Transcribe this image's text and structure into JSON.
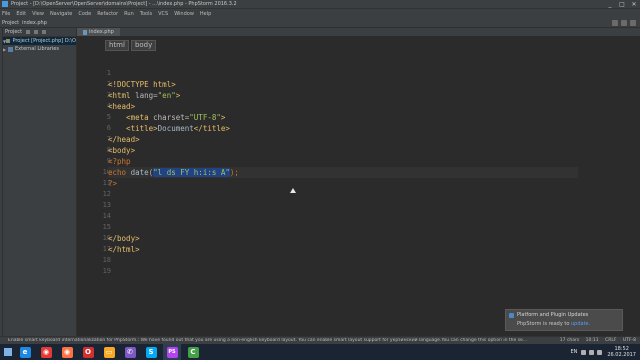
{
  "window": {
    "title": "Project - [D:\\OpenServer\\OpenServer\\domains\\Project] - ...\\index.php - PhpStorm 2016.3.2",
    "controls": [
      "_",
      "□",
      "✕"
    ]
  },
  "menu": [
    "File",
    "Edit",
    "View",
    "Navigate",
    "Code",
    "Refactor",
    "Run",
    "Tools",
    "VCS",
    "Window",
    "Help"
  ],
  "nav": {
    "crumbs": [
      "Project",
      "index.php"
    ]
  },
  "project_panel": {
    "header": "Project",
    "items": [
      {
        "label": "Project [Project.php] D:\\O",
        "selected": true,
        "kind": "folder"
      },
      {
        "label": "External Libraries",
        "selected": false,
        "kind": "libs"
      }
    ]
  },
  "editor": {
    "tab": "index.php",
    "breadcrumbs": [
      "html",
      "body"
    ],
    "line_numbers": [
      "1",
      "2",
      "3",
      "4",
      "5",
      "6",
      "7",
      "8",
      "9",
      "10",
      "11",
      "12",
      "13",
      "14",
      "15",
      "16",
      "17",
      "18",
      "19"
    ],
    "current_line": 10,
    "code": {
      "l2": "<!DOCTYPE html>",
      "l3_open": "<html ",
      "l3_attr": "lang=",
      "l3_val": "\"en\"",
      "l3_close": ">",
      "l4": "<head>",
      "l5_open": "    <meta ",
      "l5_attr": "charset=",
      "l5_val": "\"UTF-8\"",
      "l5_close": ">",
      "l6_open": "    <title>",
      "l6_text": "Document",
      "l6_close": "</title>",
      "l7": "</head>",
      "l8": "<body>",
      "l9": "<?php",
      "l10_kw": "echo ",
      "l10_fn": "date(",
      "l10_arg": "\"l ds FY h:i:s A\"",
      "l10_end": ");",
      "l11": "?>",
      "l16": "</body>",
      "l17": "</html>"
    }
  },
  "notification": {
    "title": "Platform and Plugin Updates",
    "body_prefix": "PhpStorm is ready to ",
    "link": "update."
  },
  "statusbar": {
    "message": "Enable smart keyboard internationalization for PhpStorm.: We have found out that you are using a non-english keyboard layout. You can enable smart layout support for укрэинский language.You can change this option in the se... (8 minutes ago)",
    "chars": "17 chars",
    "position": "10:11",
    "line_sep": "CRLF",
    "encoding": "UTF-8"
  },
  "taskbar": {
    "apps": [
      {
        "name": "ie",
        "glyph": "e",
        "color": "#1e88e5"
      },
      {
        "name": "chrome",
        "glyph": "◉",
        "color": "#e53935"
      },
      {
        "name": "firefox",
        "glyph": "◉",
        "color": "#ff7043"
      },
      {
        "name": "opera",
        "glyph": "O",
        "color": "#d32f2f"
      },
      {
        "name": "explorer",
        "glyph": "▭",
        "color": "#f9a825"
      },
      {
        "name": "viber",
        "glyph": "✆",
        "color": "#7e57c2"
      },
      {
        "name": "skype",
        "glyph": "S",
        "color": "#03a9f4"
      },
      {
        "name": "phpstorm",
        "glyph": "PS",
        "color": "#b345f1"
      },
      {
        "name": "ccleaner",
        "glyph": "C",
        "color": "#43a047"
      }
    ],
    "lang": "EN",
    "time": "18:52",
    "date": "26.02.2017"
  }
}
